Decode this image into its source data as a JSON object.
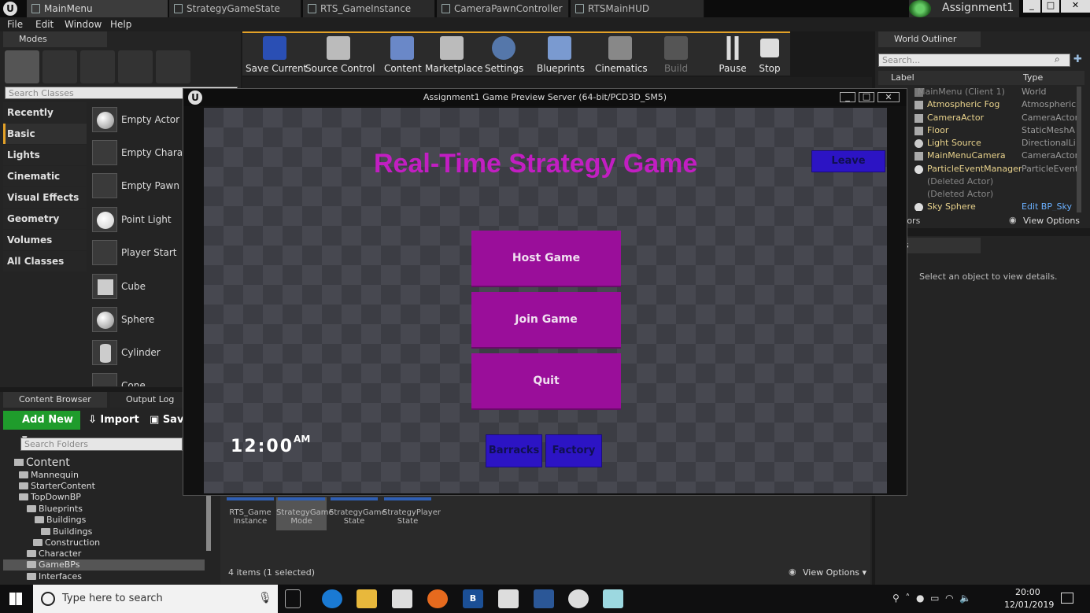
{
  "window_tabs": [
    "MainMenu",
    "StrategyGameState",
    "RTS_GameInstance",
    "CameraPawnController",
    "RTSMainHUD"
  ],
  "project_name": "Assignment1",
  "window_controls": [
    "_",
    "□",
    "✕"
  ],
  "menus": [
    "File",
    "Edit",
    "Window",
    "Help"
  ],
  "modes": {
    "tab_label": "Modes",
    "search_placeholder": "Search Classes",
    "categories": [
      "Recently Placed",
      "Basic",
      "Lights",
      "Cinematic",
      "Visual Effects",
      "Geometry",
      "Volumes",
      "All Classes"
    ],
    "items": [
      "Empty Actor",
      "Empty Charact",
      "Empty Pawn",
      "Point Light",
      "Player Start",
      "Cube",
      "Sphere",
      "Cylinder",
      "Cone"
    ]
  },
  "toolbar": [
    "Save Current",
    "Source Control",
    "Content",
    "Marketplace",
    "Settings",
    "Blueprints",
    "Cinematics",
    "Build",
    "Pause",
    "Stop"
  ],
  "outliner": {
    "tab_label": "World Outliner",
    "search_placeholder": "Search...",
    "col_label": "Label",
    "col_type": "Type",
    "rows": [
      {
        "name": "MainMenu (Client 1)",
        "type": "World"
      },
      {
        "name": "Atmospheric Fog",
        "type": "AtmosphericF"
      },
      {
        "name": "CameraActor",
        "type": "CameraActor"
      },
      {
        "name": "Floor",
        "type": "StaticMeshA"
      },
      {
        "name": "Light Source",
        "type": "DirectionalLi"
      },
      {
        "name": "MainMenuCamera",
        "type": "CameraActor"
      },
      {
        "name": "ParticleEventManager",
        "type": "ParticleEvent"
      },
      {
        "name": "(Deleted Actor)",
        "type": ""
      },
      {
        "name": "(Deleted Actor)",
        "type": ""
      },
      {
        "name": "Sky Sphere",
        "type": "Edit BP_Sky"
      }
    ],
    "actors_label": "tors",
    "view_options": "View Options"
  },
  "details": {
    "tab_label": "ails",
    "empty_text": "Select an object to view details."
  },
  "content_browser": {
    "tab_label": "Content Browser",
    "output_tab": "Output Log",
    "add_new": "Add New",
    "import": "Import",
    "save": "Save",
    "folder_search_placeholder": "Search Folders",
    "root": "Content",
    "folders": [
      "Mannequin",
      "StarterContent",
      "TopDownBP",
      "Blueprints",
      "Buildings",
      "Buildings",
      "Construction",
      "Character",
      "GameBPs",
      "Interfaces"
    ],
    "assets": [
      "RTS_Game Instance",
      "StrategyGame Mode",
      "StrategyGame State",
      "StrategyPlayer State"
    ],
    "status": "4 items (1 selected)",
    "view_options": "View Options"
  },
  "game": {
    "window_title": "Assignment1 Game Preview Server (64-bit/PCD3D_SM5)",
    "title": "Real-Time Strategy Game",
    "leave": "Leave",
    "host": "Host Game",
    "join": "Join Game",
    "quit": "Quit",
    "barracks": "Barracks",
    "factory": "Factory",
    "clock": "12:00",
    "ampm": "AM"
  },
  "taskbar": {
    "search_placeholder": "Type here to search",
    "time": "20:00",
    "date": "12/01/2019"
  },
  "colors": {
    "game_button": "#9a0e9a",
    "title_magenta": "#c21ec2",
    "blue_button": "#2c14c4",
    "accent": "#e3a228"
  }
}
